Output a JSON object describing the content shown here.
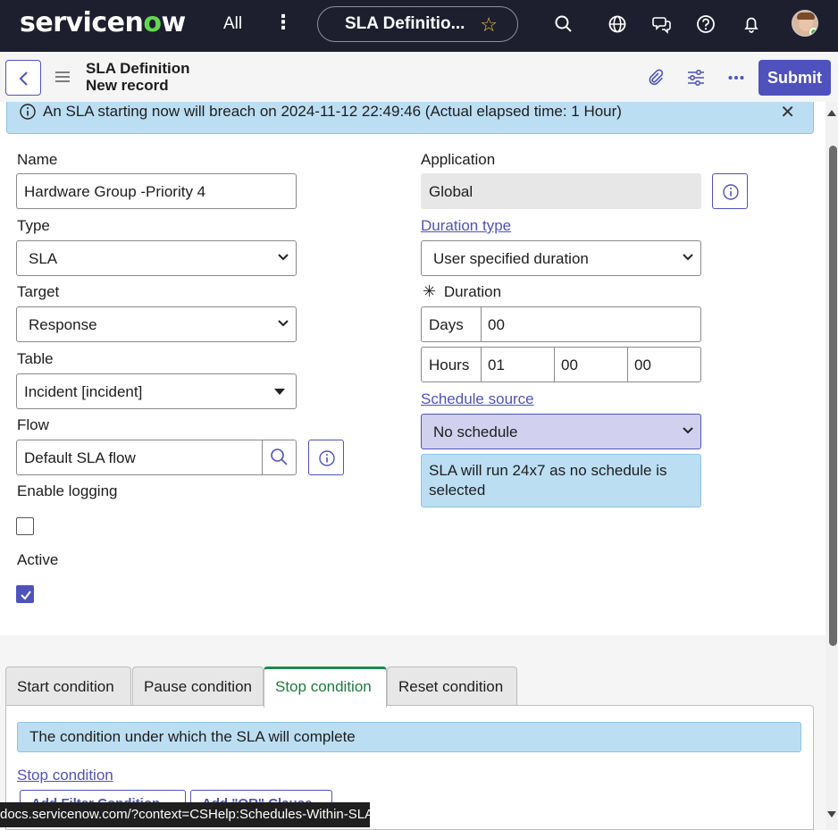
{
  "topnav": {
    "logo_main": "servicen",
    "logo_accent": "o",
    "logo_end": "w",
    "all_label": "All",
    "kebab": "⋮",
    "pill_title": "SLA Definitio...",
    "star": "☆"
  },
  "header": {
    "title_line1": "SLA Definition",
    "title_line2": "New record",
    "submit_label": "Submit"
  },
  "banner": {
    "text": "An SLA starting now will breach on 2024-11-12 22:49:46 (Actual elapsed time: 1 Hour)",
    "close": "✕"
  },
  "form": {
    "name_label": "Name",
    "name_value": "Hardware Group -Priority 4",
    "type_label": "Type",
    "type_value": "SLA",
    "target_label": "Target",
    "target_value": "Response",
    "table_label": "Table",
    "table_value": "Incident [incident]",
    "flow_label": "Flow",
    "flow_value": "Default SLA flow",
    "logging_label": "Enable logging",
    "logging_checked": false,
    "active_label": "Active",
    "active_checked": true,
    "application_label": "Application",
    "application_value": "Global",
    "duration_type_label": "Duration type",
    "duration_type_value": "User specified duration",
    "duration_label": "Duration",
    "duration_required": "✳",
    "days_label": "Days",
    "days_value": "00",
    "hours_label": "Hours",
    "hours_value": "01",
    "minutes_value": "00",
    "seconds_value": "00",
    "schedule_source_label": "Schedule source",
    "schedule_source_value": "No schedule",
    "schedule_note": "SLA will run 24x7 as no schedule is selected"
  },
  "tabs": {
    "items": [
      "Start condition",
      "Pause condition",
      "Stop condition",
      "Reset condition"
    ],
    "active": "Stop condition"
  },
  "stop_condition": {
    "banner": "The condition under which the SLA will complete",
    "link": "Stop condition",
    "button1": "Add Filter Condition",
    "button2": "Add \"OR\" Clause"
  },
  "status_tooltip": "docs.servicenow.com/?context=CSHelp:Schedules-Within-SLA",
  "colors": {
    "nav_bg": "#1d1f2f",
    "primary": "#4f52bd",
    "info_bg": "#bcdef3",
    "active_tab": "#1f8a4c",
    "logo_accent": "#62d84e"
  }
}
